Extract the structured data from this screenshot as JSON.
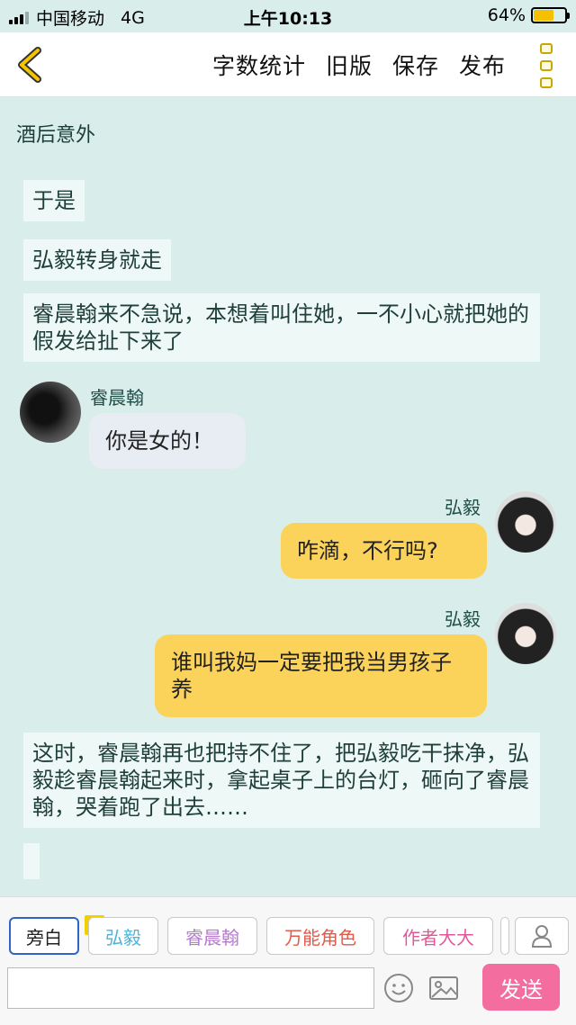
{
  "status_bar": {
    "carrier": "中国移动",
    "network": "4G",
    "time": "上午10:13",
    "battery": "64%"
  },
  "nav": {
    "actions": [
      "字数统计",
      "旧版",
      "保存",
      "发布"
    ]
  },
  "chapter_title": "酒后意外",
  "narrations": [
    "于是",
    "弘毅转身就走",
    "睿晨翰来不急说，本想着叫住她，一不小心就把她的假发给扯下来了",
    "这时，睿晨翰再也把持不住了，把弘毅吃干抹净，弘毅趁睿晨翰起来时，拿起桌子上的台灯，砸向了睿晨翰，哭着跑了出去……"
  ],
  "messages": [
    {
      "sender": "睿晨翰",
      "text": "你是女的！",
      "side": "left"
    },
    {
      "sender": "弘毅",
      "text": "咋滴，不行吗?",
      "side": "right"
    },
    {
      "sender": "弘毅",
      "text": "谁叫我妈一定要把我当男孩子养",
      "side": "right"
    }
  ],
  "toolbar": {
    "roles": [
      {
        "label": "旁白",
        "color": "#222222"
      },
      {
        "label": "弘毅",
        "color": "#4fb3d6"
      },
      {
        "label": "睿晨翰",
        "color": "#b77ad0"
      },
      {
        "label": "万能角色",
        "color": "#e05b4b"
      },
      {
        "label": "作者大大",
        "color": "#e0589a"
      }
    ],
    "host_badge": "主",
    "send_label": "发送"
  },
  "colors": {
    "background": "#d9eeea",
    "right_bubble": "#fcd35a",
    "left_bubble": "#e8ecf3",
    "send": "#f36d9f"
  }
}
